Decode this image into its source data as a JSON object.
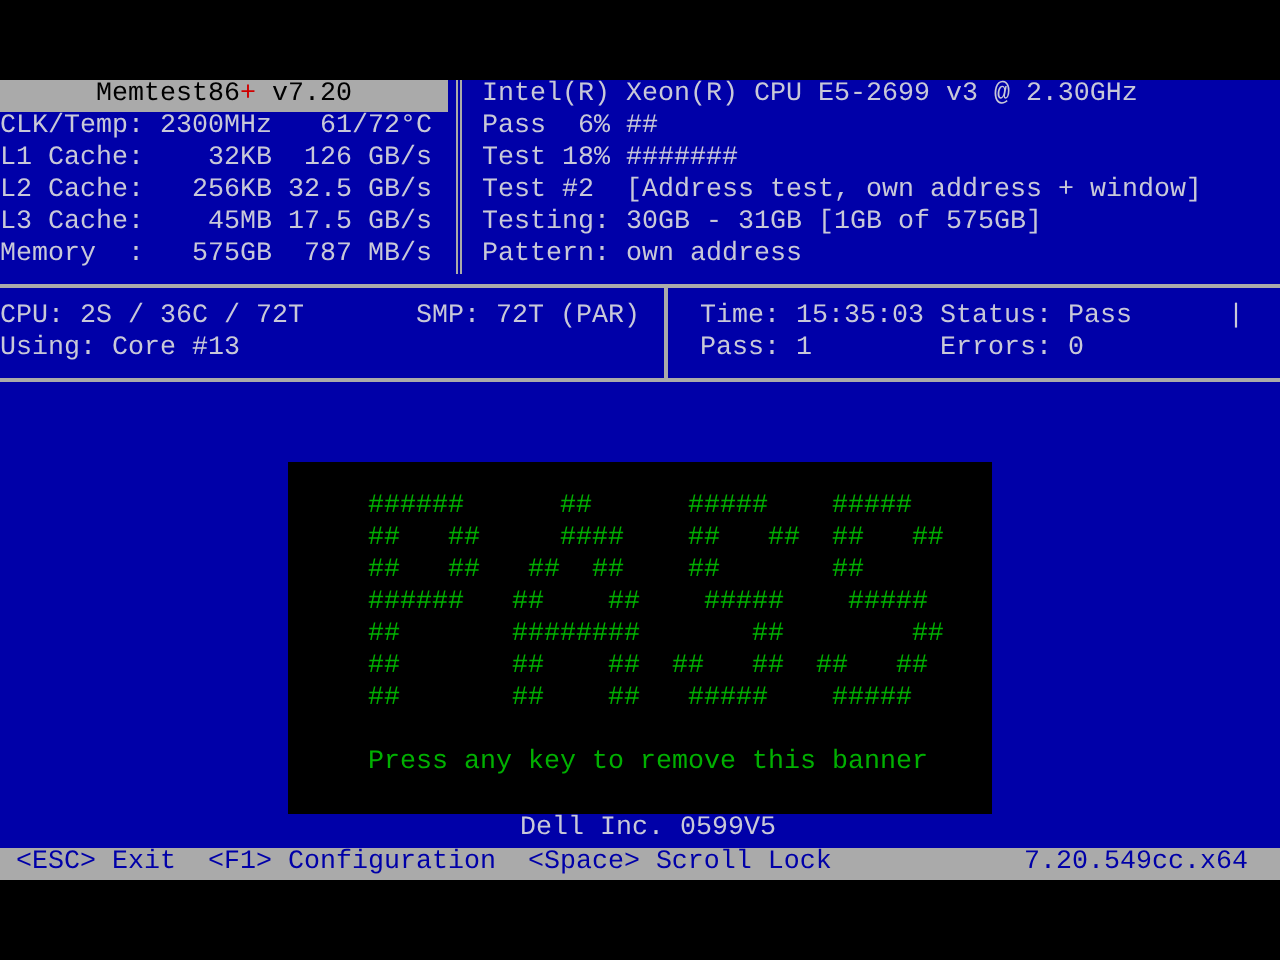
{
  "header": {
    "product": "Memtest86",
    "product_mark": "+",
    "version": "v7.20"
  },
  "system": [
    {
      "label": "CLK/Temp:",
      "value": "2300MHz",
      "rate": "61/72°C"
    },
    {
      "label": "L1 Cache:",
      "value": "32KB",
      "rate": "126 GB/s"
    },
    {
      "label": "L2 Cache:",
      "value": "256KB",
      "rate": "32.5 GB/s"
    },
    {
      "label": "L3 Cache:",
      "value": "45MB",
      "rate": "17.5 GB/s"
    },
    {
      "label": "Memory  :",
      "value": "575GB",
      "rate": "787 MB/s"
    }
  ],
  "cpu_name": "Intel(R) Xeon(R) CPU E5-2699 v3 @ 2.30GHz",
  "progress": [
    {
      "label": "Pass",
      "percent": "6%",
      "bar": "##"
    },
    {
      "label": "Test",
      "percent": "18%",
      "bar": "#######"
    }
  ],
  "details": [
    {
      "label": "Test #2",
      "value": "[Address test, own address + window]"
    },
    {
      "label": "Testing:",
      "value": "30GB - 31GB [1GB of 575GB]"
    },
    {
      "label": "Pattern:",
      "value": "own address"
    }
  ],
  "cpu": {
    "topology": "CPU: 2S / 36C / 72T",
    "smp": "SMP: 72T (PAR)",
    "using": "Using: Core #13"
  },
  "run": {
    "time_label": "Time:",
    "time": "15:35:03",
    "status_label": "Status:",
    "status": "Pass",
    "spinner": "|",
    "pass_label": "Pass:",
    "pass": "1",
    "errors_label": "Errors:",
    "errors": "0"
  },
  "banner": {
    "art": [
      "######      ##      #####    #####",
      "##   ##     ####    ##   ##  ##   ##",
      "##   ##   ##  ##    ##       ##",
      "######   ##    ##    #####    #####",
      "##       ########       ##        ##",
      "##       ##    ##  ##   ##  ##   ##",
      "##       ##    ##   #####    #####"
    ],
    "message": "Press any key to remove this banner"
  },
  "vendor": "Dell Inc. 0599V5",
  "footer": {
    "keys": [
      "<ESC> Exit",
      "<F1> Configuration",
      "<Space> Scroll Lock"
    ],
    "build": "7.20.549cc.x64"
  }
}
